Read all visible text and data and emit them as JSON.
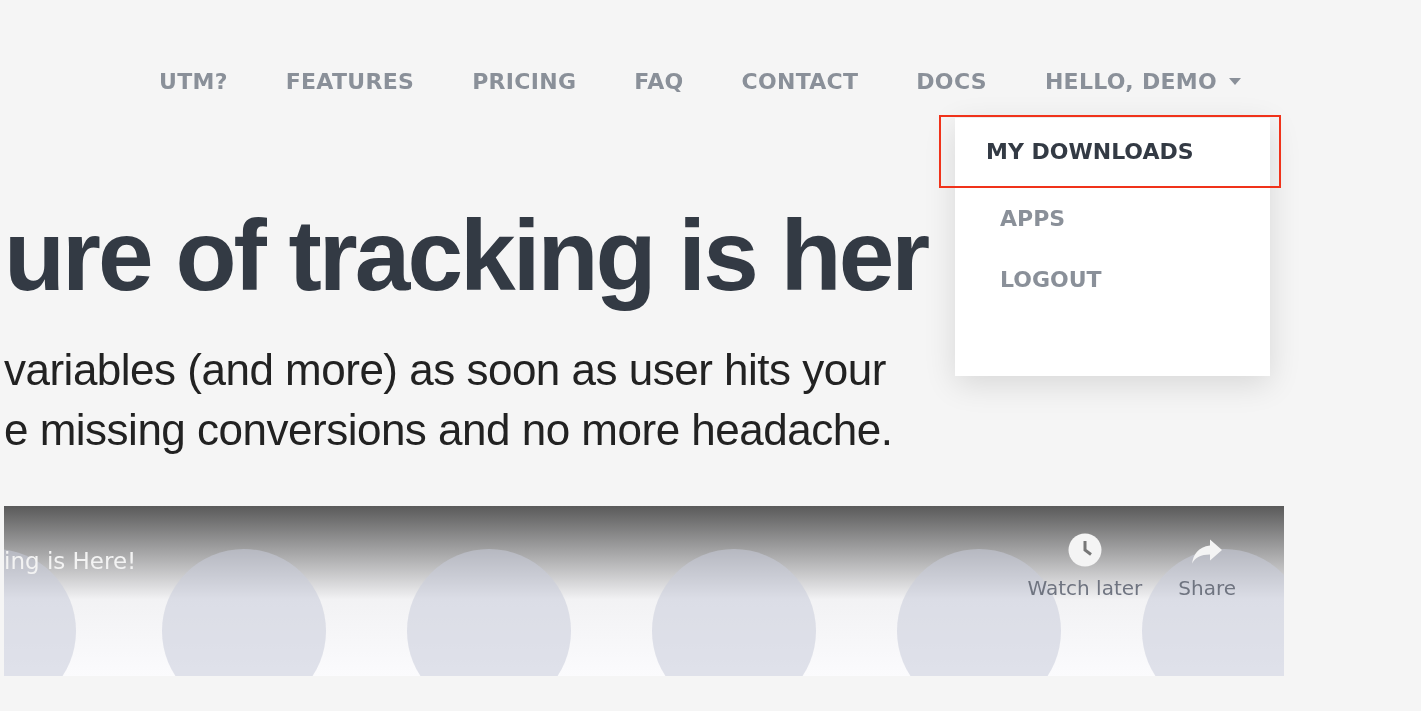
{
  "nav": {
    "items": [
      "UTM?",
      "FEATURES",
      "PRICING",
      "FAQ",
      "CONTACT",
      "DOCS"
    ],
    "account": {
      "label": "HELLO, DEMO",
      "expanded": true
    }
  },
  "dropdown": {
    "items": [
      {
        "label": "MY DOWNLOADS",
        "selected": true
      },
      {
        "label": "APPS",
        "selected": false
      },
      {
        "label": "LOGOUT",
        "selected": false
      }
    ]
  },
  "hero": {
    "title": "ure of tracking is her",
    "subtitle_lines": [
      "variables (and more) as soon as user hits your",
      "e missing conversions and no more headache."
    ]
  },
  "video": {
    "title": "ing is Here!",
    "actions": [
      {
        "kind": "watch",
        "label": "Watch later"
      },
      {
        "kind": "share",
        "label": "Share"
      }
    ]
  }
}
